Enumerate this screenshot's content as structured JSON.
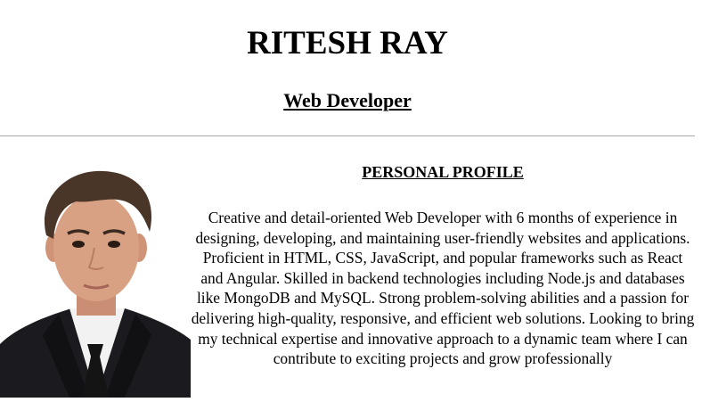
{
  "header": {
    "name": "RITESH RAY",
    "role": "Web Developer"
  },
  "profile": {
    "title": "PERSONAL PROFILE",
    "text": "Creative and detail-oriented Web Developer with 6 months of experience in designing, developing, and maintaining user-friendly websites and applications. Proficient in HTML, CSS, JavaScript, and popular frameworks such as React and Angular. Skilled in backend technologies including Node.js and databases like MongoDB and MySQL. Strong problem-solving abilities and a passion for delivering high-quality, responsive, and efficient web solutions. Looking to bring my technical expertise and innovative approach to a dynamic team where I can contribute to exciting projects and grow professionally"
  },
  "colors": {
    "suit": "#1b1b1f",
    "shirt": "#f2f2f2",
    "tie": "#141414",
    "skin": "#d8a184",
    "hair": "#4a3629",
    "divider": "#a9a9a9"
  }
}
